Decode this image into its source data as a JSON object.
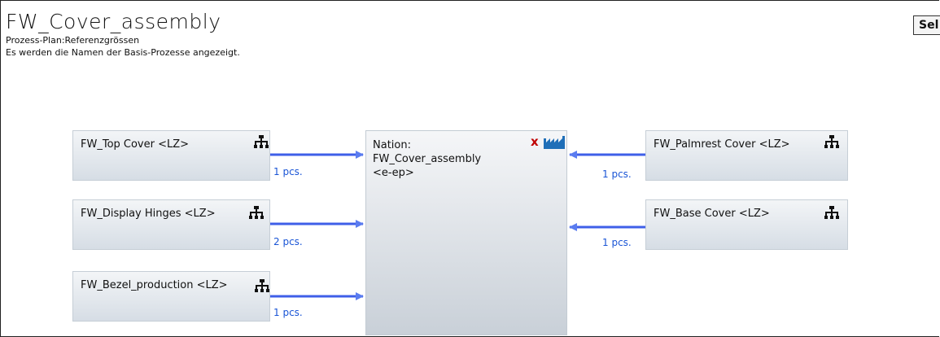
{
  "header": {
    "title": "FW_Cover_assembly",
    "subtitle": "Prozess-Plan:Referenzgrössen",
    "note": "Es werden die Namen der Basis-Prozesse angezeigt.",
    "select_button": "Sel"
  },
  "center_node": {
    "line1": "Nation:",
    "line2": "FW_Cover_assembly",
    "line3": "<e-ep>",
    "x_icon": "x",
    "icons": [
      "close-x-icon",
      "factory-icon"
    ]
  },
  "left_nodes": [
    {
      "label": "FW_Top Cover <LZ>",
      "quantity": "1 pcs.",
      "icon": "hierarchy-icon"
    },
    {
      "label": "FW_Display Hinges <LZ>",
      "quantity": "2 pcs.",
      "icon": "hierarchy-icon"
    },
    {
      "label": "FW_Bezel_production <LZ>",
      "quantity": "1 pcs.",
      "icon": "hierarchy-icon"
    }
  ],
  "right_nodes": [
    {
      "label": "FW_Palmrest Cover <LZ>",
      "quantity": "1 pcs.",
      "icon": "hierarchy-icon"
    },
    {
      "label": "FW_Base Cover <LZ>",
      "quantity": "1 pcs.",
      "icon": "hierarchy-icon"
    }
  ],
  "colors": {
    "arrow": "#3a5ce8",
    "quantity_text": "#1a55d6",
    "x_icon": "#c00000",
    "factory_icon": "#1f6fb8"
  }
}
